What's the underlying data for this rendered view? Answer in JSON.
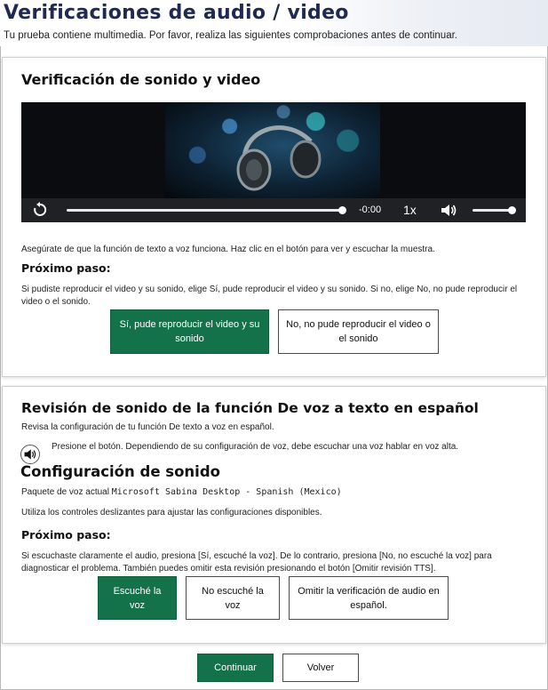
{
  "header": {
    "title": "Verificaciones de audio / video",
    "subtitle": "Tu prueba contiene multimedia. Por favor, realiza las siguientes comprobaciones antes de continuar."
  },
  "video_check": {
    "title": "Verificación de sonido y video",
    "player": {
      "time": "-0:00",
      "speed": "1x",
      "progress": 1.0,
      "volume": 1.0
    },
    "instruction": "Asegúrate de que la función de texto a voz funciona. Haz clic en el botón para ver y escuchar la muestra.",
    "next_step_label": "Próximo paso:",
    "next_step_text": "Si pudiste reproducir el video y su sonido, elige Sí, pude reproducir el video y su sonido. Si no, elige No, no pude reproducir el video o el sonido.",
    "yes_button": "Sí, pude reproducir el video y su sonido",
    "no_button": "No, no pude reproducir el video o el sonido"
  },
  "tts_check": {
    "title": "Revisión de sonido de la función De voz a texto en español",
    "intro": "Revisa la configuración de tu función De texto a voz en español.",
    "speaker_hint": "Presione el botón. Dependiendo de su configuración de voz, debe escuchar una voz hablar en voz alta.",
    "config_title": "Configuración de sonido",
    "voice_pack_label": "Paquete de voz actual",
    "voice_pack_value": "Microsoft Sabina Desktop - Spanish (Mexico)",
    "sliders_text": "Utiliza los controles deslizantes para ajustar las configuraciones disponibles.",
    "next_step_label": "Próximo paso:",
    "next_step_text": "Si escuchaste claramente el audio, presiona [Sí, escuché la voz]. De lo contrario, presiona [No, no escuché la voz] para diagnosticar el problema. También puedes omitir esta revisión presionando el botón [Omitir revisión TTS].",
    "heard_button": "Escuché la voz",
    "not_heard_button": "No escuché la voz",
    "skip_button": "Omitir la verificación de audio en español."
  },
  "footer": {
    "continue_button": "Continuar",
    "back_button": "Volver"
  },
  "colors": {
    "primary": "#13724a",
    "title": "#1f2a4e"
  }
}
